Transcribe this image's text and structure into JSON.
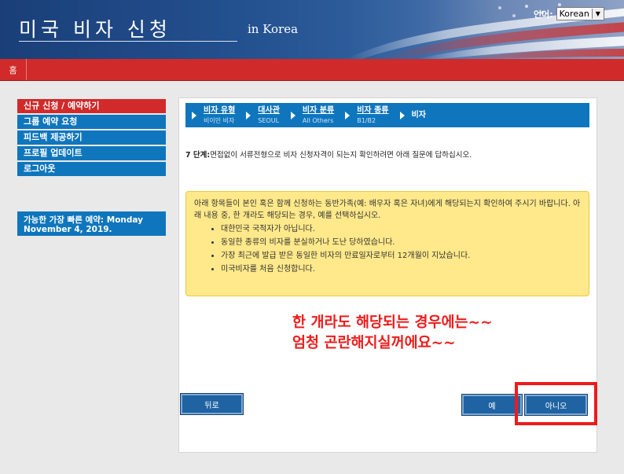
{
  "header": {
    "title": "미국 비자 신청",
    "subtitle": "in Korea",
    "language_label": "언어:",
    "language_value": "Korean"
  },
  "nav": {
    "home": "홈"
  },
  "sidebar": {
    "items": [
      {
        "label": "신규 신청 / 예약하기",
        "active": true
      },
      {
        "label": "그룹 예약 요청",
        "active": false
      },
      {
        "label": "피드백 제공하기",
        "active": false
      },
      {
        "label": "프로필 업데이트",
        "active": false
      },
      {
        "label": "로그아웃",
        "active": false
      }
    ],
    "appointment_note": "가능한 가장 빠른 예약: Monday November 4, 2019."
  },
  "steps": [
    {
      "label": "비자 유형",
      "value": "비이민 비자"
    },
    {
      "label": "대사관",
      "value": "SEOUL"
    },
    {
      "label": "비자 분류",
      "value": "All Others"
    },
    {
      "label": "비자 종류",
      "value": "B1/B2"
    },
    {
      "label": "비자",
      "value": ""
    }
  ],
  "question": {
    "step": "7 단계:",
    "text": "면접없이 서류전형으로 비자 신청자격이 되는지 확인하려면 아래 질문에 답하십시오."
  },
  "notice": {
    "intro": "아래 항목들이 본인 혹은 함께 신청하는 동반가족(예: 배우자 혹은 자녀)에게 해당되는지 확인하여 주시기 바랍니다.  아래 내용 중, 한 개라도 해당되는 경우, 예를 선택하십시오.",
    "bullets": [
      "대한민국 국적자가 아닙니다.",
      "동일한 종류의 비자를 분실하거나 도난 당하였습니다.",
      "가장 최근에 발급 받은 동일한 비자의 만료일자로부터 12개월이 지났습니다.",
      "미국비자를 처음 신청합니다."
    ]
  },
  "annotation": {
    "line1": "한 개라도 해당되는 경우에는~~",
    "line2": "엄청 곤란해지실꺼에요~~"
  },
  "buttons": {
    "back": "뒤로",
    "yes": "예",
    "no": "아니오"
  },
  "colors": {
    "nav_red": "#d02a2a",
    "sidebar_blue": "#0f76bd",
    "notice_yellow": "#ffe98a",
    "annotation_red": "#ee1b1b",
    "button_blue": "#1f63a3"
  }
}
